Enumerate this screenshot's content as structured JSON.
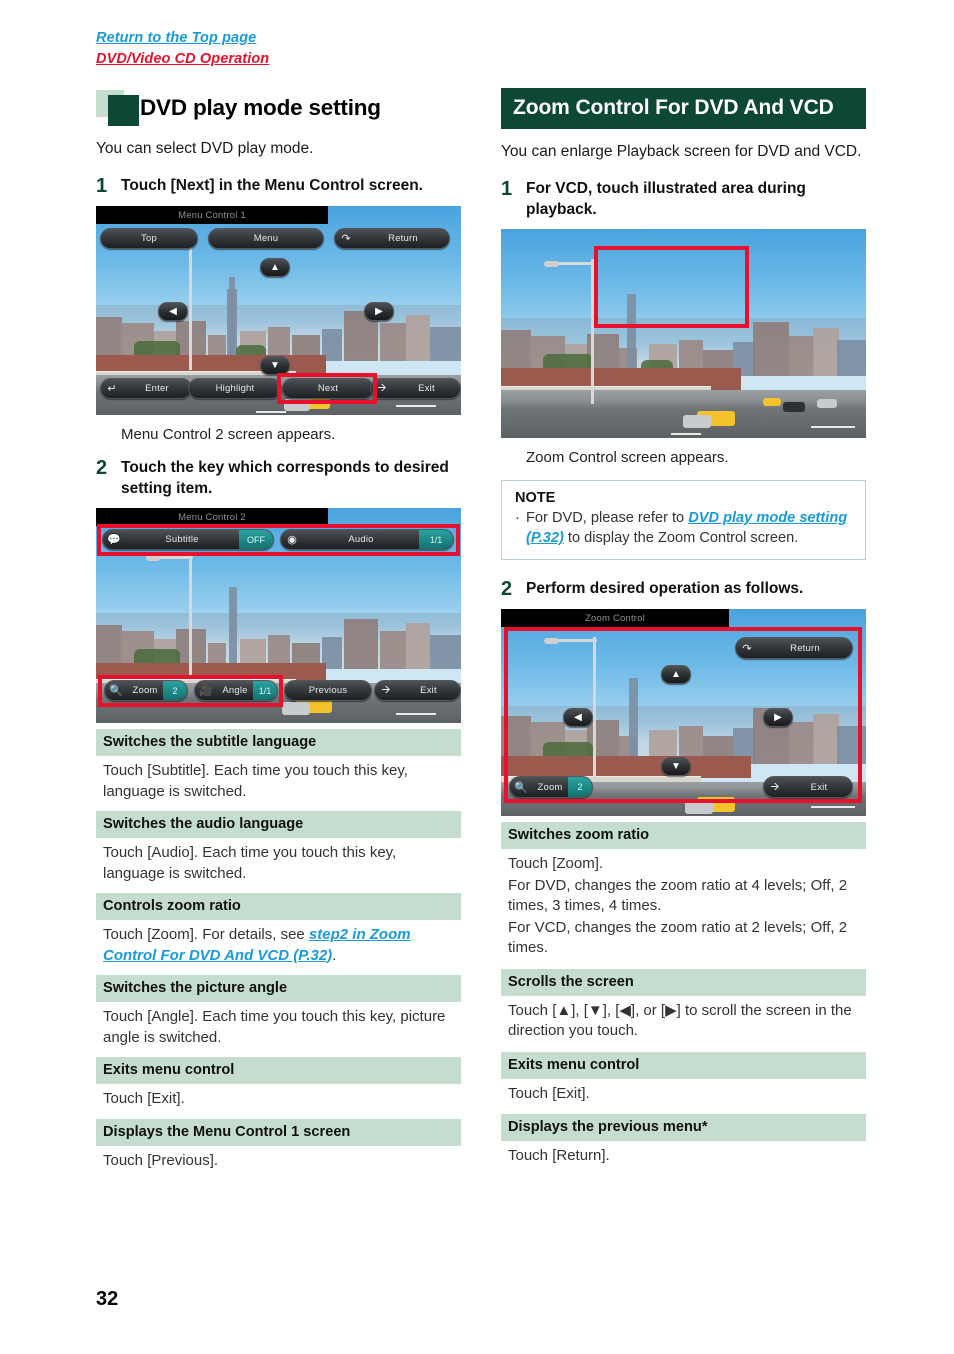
{
  "top_links": {
    "return_top": "Return to the Top page",
    "section": "DVD/Video CD Operation"
  },
  "colors": {
    "dark_green": "#0d4736",
    "light_green": "#c5ddcf",
    "link_blue": "#1a9ad6",
    "link_red": "#e8112d",
    "highlight_red": "#e8112d"
  },
  "page_number": "32",
  "left": {
    "heading": "DVD play mode setting",
    "intro": "You can select DVD play mode.",
    "steps": [
      {
        "num": "1",
        "text": "Touch [Next] in the Menu Control screen."
      },
      {
        "num": "2",
        "text": "Touch the key which corresponds to desired setting item."
      }
    ],
    "caption_after_step1": "Menu Control 2 screen appears.",
    "screen1": {
      "title": "Menu Control 1",
      "buttons": {
        "top": "Top",
        "menu": "Menu",
        "return": "Return",
        "enter": "Enter",
        "highlight": "Highlight",
        "next": "Next",
        "exit": "Exit"
      },
      "highlighted": "Next"
    },
    "screen2": {
      "title": "Menu Control 2",
      "buttons": {
        "subtitle": "Subtitle",
        "subtitle_value": "OFF",
        "audio": "Audio",
        "audio_value": "1/1",
        "zoom": "Zoom",
        "zoom_value": "2",
        "angle": "Angle",
        "angle_value": "1/1",
        "previous": "Previous",
        "exit": "Exit"
      }
    },
    "descriptions": [
      {
        "head": "Switches the subtitle language",
        "body": "Touch [Subtitle]. Each time you touch this key, language is switched."
      },
      {
        "head": "Switches the audio language",
        "body": "Touch [Audio]. Each time you touch this key, language is switched."
      },
      {
        "head": "Controls zoom ratio",
        "body_pre": "Touch [Zoom]. For details, see ",
        "body_link": "step2 in Zoom Control For DVD And VCD (P.32)",
        "body_post": "."
      },
      {
        "head": "Switches the picture angle",
        "body": "Touch [Angle]. Each time you touch this key, picture angle is switched."
      },
      {
        "head": "Exits menu control",
        "body": "Touch [Exit]."
      },
      {
        "head": "Displays the Menu Control 1 screen",
        "body": "Touch [Previous]."
      }
    ]
  },
  "right": {
    "heading": "Zoom Control For DVD And VCD",
    "intro": "You can enlarge Playback screen for DVD and VCD.",
    "steps": [
      {
        "num": "1",
        "text": "For VCD, touch illustrated area during playback."
      },
      {
        "num": "2",
        "text": "Perform desired operation as follows."
      }
    ],
    "caption_after_step1": "Zoom Control screen appears.",
    "note": {
      "title": "NOTE",
      "bullet_pre": "For DVD, please refer to ",
      "bullet_link": "DVD play mode setting (P.32)",
      "bullet_post": " to display the Zoom Control screen."
    },
    "screen_zoom": {
      "title": "Zoom Control",
      "buttons": {
        "return": "Return",
        "zoom": "Zoom",
        "zoom_value": "2",
        "exit": "Exit"
      },
      "arrows": {
        "up": "▲",
        "down": "▼",
        "left": "◀",
        "right": "▶"
      }
    },
    "descriptions": [
      {
        "head": "Switches zoom ratio",
        "lines": [
          "Touch [Zoom].",
          "For DVD, changes the zoom ratio at 4 levels; Off, 2 times, 3 times, 4 times.",
          "For VCD, changes the zoom ratio at 2 levels; Off, 2 times."
        ]
      },
      {
        "head": "Scrolls the screen",
        "lines": [
          "Touch [▲], [▼], [◀], or [▶] to scroll the screen in the direction you touch."
        ]
      },
      {
        "head": "Exits menu control",
        "lines": [
          "Touch [Exit]."
        ]
      },
      {
        "head": "Displays the previous menu*",
        "lines": [
          "Touch [Return]."
        ]
      }
    ]
  }
}
